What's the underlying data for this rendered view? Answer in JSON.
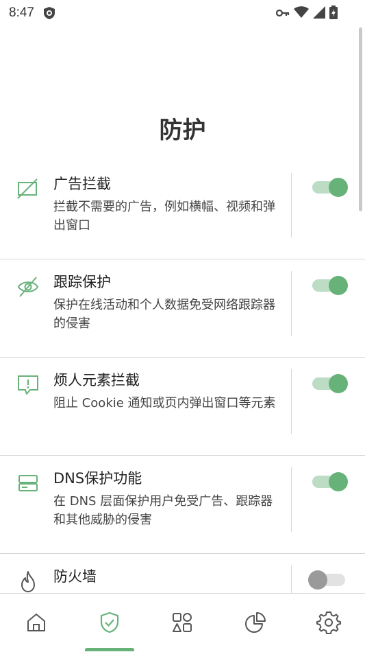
{
  "status_bar": {
    "time": "8:47"
  },
  "page": {
    "title": "防护"
  },
  "features": [
    {
      "name": "广告拦截",
      "desc": "拦截不需要的广告，例如横幅、视频和弹出窗口",
      "icon": "ad-block-icon",
      "enabled": true
    },
    {
      "name": "跟踪保护",
      "desc": "保护在线活动和个人数据免受网络跟踪器的侵害",
      "icon": "eye-off-icon",
      "enabled": true
    },
    {
      "name": "烦人元素拦截",
      "desc": "阻止 Cookie 通知或页内弹出窗口等元素",
      "icon": "alert-message-icon",
      "enabled": true
    },
    {
      "name": "DNS保护功能",
      "desc": "在 DNS 层面保护用户免受广告、跟踪器和其他威胁的侵害",
      "icon": "server-icon",
      "enabled": true
    },
    {
      "name": "防火墙",
      "desc": "",
      "icon": "flame-icon",
      "enabled": false
    }
  ],
  "bottom_nav": [
    {
      "icon": "home-icon",
      "active": false
    },
    {
      "icon": "shield-check-icon",
      "active": true
    },
    {
      "icon": "apps-icon",
      "active": false
    },
    {
      "icon": "pie-chart-icon",
      "active": false
    },
    {
      "icon": "gear-icon",
      "active": false
    }
  ],
  "colors": {
    "accent": "#67b279",
    "accent_light": "#bcdcc4",
    "icon_inactive": "#555555"
  }
}
